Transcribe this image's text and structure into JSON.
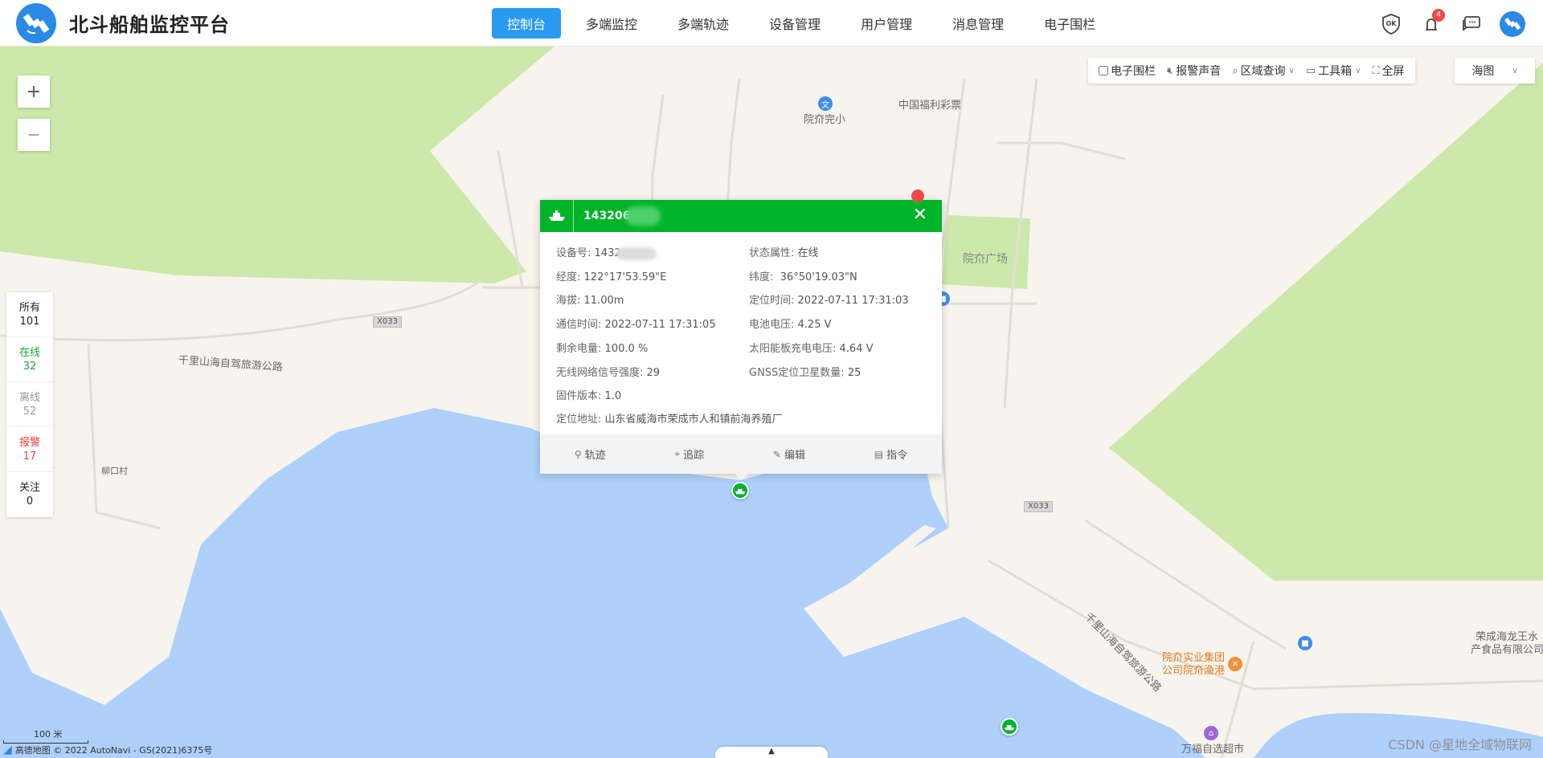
{
  "header": {
    "title": "北斗船舶监控平台",
    "nav": [
      {
        "label": "控制台",
        "active": true
      },
      {
        "label": "多端监控",
        "active": false
      },
      {
        "label": "多端轨迹",
        "active": false
      },
      {
        "label": "设备管理",
        "active": false
      },
      {
        "label": "用户管理",
        "active": false
      },
      {
        "label": "消息管理",
        "active": false
      },
      {
        "label": "电子围栏",
        "active": false
      }
    ],
    "icons": {
      "ok": "OK",
      "alarm_count": "4"
    }
  },
  "map": {
    "zoom_in": "+",
    "zoom_out": "—",
    "stats": [
      {
        "label": "所有",
        "value": "101",
        "color": "#222222"
      },
      {
        "label": "在线",
        "value": "32",
        "color": "#19a83a"
      },
      {
        "label": "离线",
        "value": "52",
        "color": "#999999"
      },
      {
        "label": "报警",
        "value": "17",
        "color": "#f03c3c"
      },
      {
        "label": "关注",
        "value": "0",
        "color": "#222222"
      }
    ],
    "toolbar": {
      "fence": "电子围栏",
      "sound": "报警声音",
      "region": "区域查询",
      "toolbox": "工具箱",
      "fullscreen": "全屏"
    },
    "layer": "海图",
    "labels": {
      "road1": "千里山海自驾旅游公路",
      "road2": "千里山海自驾旅游公路",
      "x033a": "X033",
      "x033b": "X033",
      "school": "院夼完小",
      "lottery": "中国福利彩票",
      "square": "院夼广场",
      "village": "柳口村",
      "company1": "院夼实业集团",
      "company2": "公司院夼渔港",
      "food1": "荣成海龙王水",
      "food2": "产食品有限公司",
      "market": "万福自选超市"
    },
    "scale": "100 米",
    "copyright": "高德地图 © 2022 AutoNavi - GS(2021)6375号",
    "watermark": "CSDN @星地全域物联网"
  },
  "popup": {
    "id_prefix": "143206",
    "fields": {
      "device_label": "设备号:",
      "device_value": "1432",
      "status_label": "状态属性:",
      "status_value": "在线",
      "lng_label": "经度:",
      "lng_value": "122°17'53.59\"E",
      "lat_label": "纬度:",
      "lat_value": "36°50'19.03\"N",
      "alt_label": "海拔:",
      "alt_value": "11.00m",
      "loc_time_label": "定位时间:",
      "loc_time_value": "2022-07-11 17:31:03",
      "comm_time_label": "通信时间:",
      "comm_time_value": "2022-07-11 17:31:05",
      "battery_v_label": "电池电压:",
      "battery_v_value": "4.25 V",
      "remain_label": "剩余电量:",
      "remain_value": "100.0 %",
      "solar_label": "太阳能板充电电压:",
      "solar_value": "4.64 V",
      "signal_label": "无线网络信号强度:",
      "signal_value": "29",
      "gnss_label": "GNSS定位卫星数量:",
      "gnss_value": "25",
      "fw_label": "固件版本:",
      "fw_value": "1.0",
      "addr_label": "定位地址:",
      "addr_value": "山东省威海市荣成市人和镇前海养殖厂"
    },
    "actions": {
      "track": "轨迹",
      "follow": "追踪",
      "edit": "编辑",
      "command": "指令"
    }
  },
  "colors": {
    "accent": "#2a9af0",
    "online": "#00b42a",
    "water": "#aed0fb",
    "green_area": "#cde8aa"
  }
}
